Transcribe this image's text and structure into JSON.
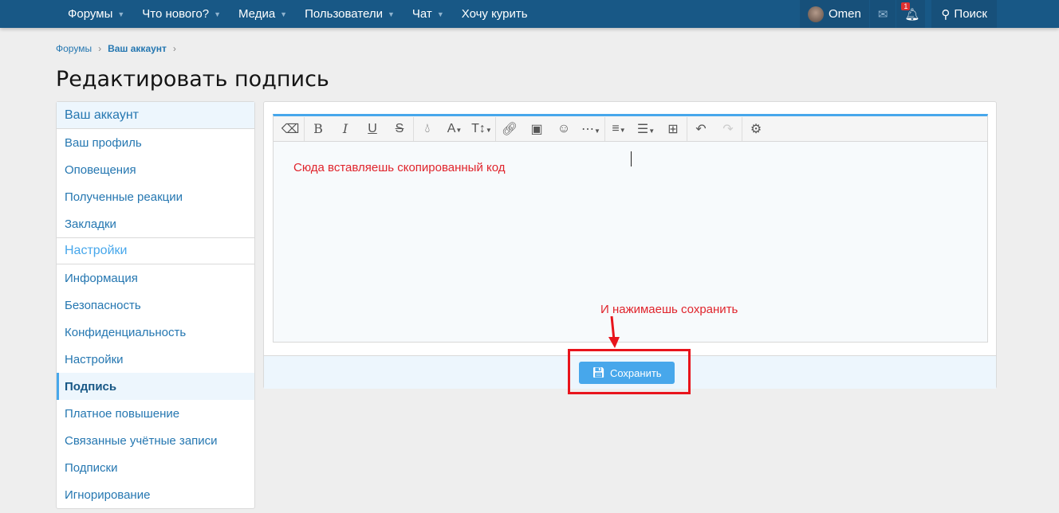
{
  "nav": {
    "items": [
      {
        "label": "Форумы",
        "caret": true
      },
      {
        "label": "Что нового?",
        "caret": true
      },
      {
        "label": "Медиа",
        "caret": true
      },
      {
        "label": "Пользователи",
        "caret": true
      },
      {
        "label": "Чат",
        "caret": true
      },
      {
        "label": "Хочу курить",
        "caret": false
      }
    ],
    "user": "Omen",
    "alert_count": "1",
    "search": "Поиск"
  },
  "breadcrumb": [
    "Форумы",
    "Ваш аккаунт"
  ],
  "title": "Редактировать подпись",
  "sidebar": {
    "group1": "Ваш аккаунт",
    "items1": [
      "Ваш профиль",
      "Оповещения",
      "Полученные реакции",
      "Закладки"
    ],
    "group2": "Настройки",
    "items2": [
      "Информация",
      "Безопасность",
      "Конфиденциальность",
      "Настройки",
      "Подпись",
      "Платное повышение",
      "Связанные учётные записи",
      "Подписки",
      "Игнорирование"
    ],
    "active": "Подпись"
  },
  "editor": {
    "toolbar": [
      "eraser",
      "bold",
      "italic",
      "underline",
      "strikethrough",
      "color",
      "font",
      "size",
      "link",
      "image",
      "smiley",
      "more",
      "align",
      "list",
      "table",
      "undo",
      "redo",
      "settings"
    ],
    "annotation": "Сюда вставляешь скопированный код"
  },
  "save_label": "Сохранить",
  "annotation2": "И нажимаешь сохранить",
  "colors": {
    "nav": "#185886",
    "accent": "#47a7eb",
    "annotation": "#e0242c"
  }
}
